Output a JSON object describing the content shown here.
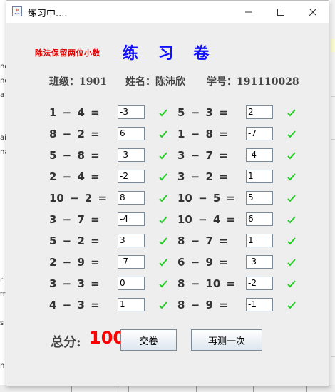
{
  "window": {
    "title": "练习中...."
  },
  "header": {
    "hint": "除法保留两位小数",
    "title": "练 习 卷",
    "class_label": "班级：1901",
    "name_label": "姓名：陈沛欣",
    "id_label": "学号：191110028"
  },
  "questions": [
    {
      "left": {
        "q": "1 − 4 =",
        "a": "-3"
      },
      "right": {
        "q": "5 − 3 =",
        "a": "2"
      }
    },
    {
      "left": {
        "q": "8 − 2 =",
        "a": "6"
      },
      "right": {
        "q": "1 − 8 =",
        "a": "-7"
      }
    },
    {
      "left": {
        "q": "5 − 8 =",
        "a": "-3"
      },
      "right": {
        "q": "3 − 7 =",
        "a": "-4"
      }
    },
    {
      "left": {
        "q": "2 − 4 =",
        "a": "-2"
      },
      "right": {
        "q": "3 − 2 =",
        "a": "1"
      }
    },
    {
      "left": {
        "q": "10 − 2 =",
        "a": "8"
      },
      "right": {
        "q": "10 − 5 =",
        "a": "5"
      }
    },
    {
      "left": {
        "q": "3 − 7 =",
        "a": "-4"
      },
      "right": {
        "q": "10 − 4 =",
        "a": "6"
      }
    },
    {
      "left": {
        "q": "5 − 2 =",
        "a": "3"
      },
      "right": {
        "q": "8 − 7 =",
        "a": "1"
      }
    },
    {
      "left": {
        "q": "2 − 9 =",
        "a": "-7"
      },
      "right": {
        "q": "6 − 9 =",
        "a": "-3"
      }
    },
    {
      "left": {
        "q": "3 − 3 =",
        "a": "0"
      },
      "right": {
        "q": "8 − 10 =",
        "a": "-2"
      }
    },
    {
      "left": {
        "q": "4 − 3 =",
        "a": "1"
      },
      "right": {
        "q": "8 − 9 =",
        "a": "-1"
      }
    }
  ],
  "footer": {
    "total_label": "总分:",
    "total_score": "100",
    "submit_label": "交卷",
    "retry_label": "再测一次"
  },
  "background": {
    "left_fragments": [
      "nd",
      "nd",
      "a",
      "ai",
      "na",
      "r",
      "tt",
      "s",
      "n"
    ]
  },
  "colors": {
    "check": "#22cc22",
    "score": "#ff0000",
    "heading": "#1010ff",
    "hint": "#e00000"
  }
}
